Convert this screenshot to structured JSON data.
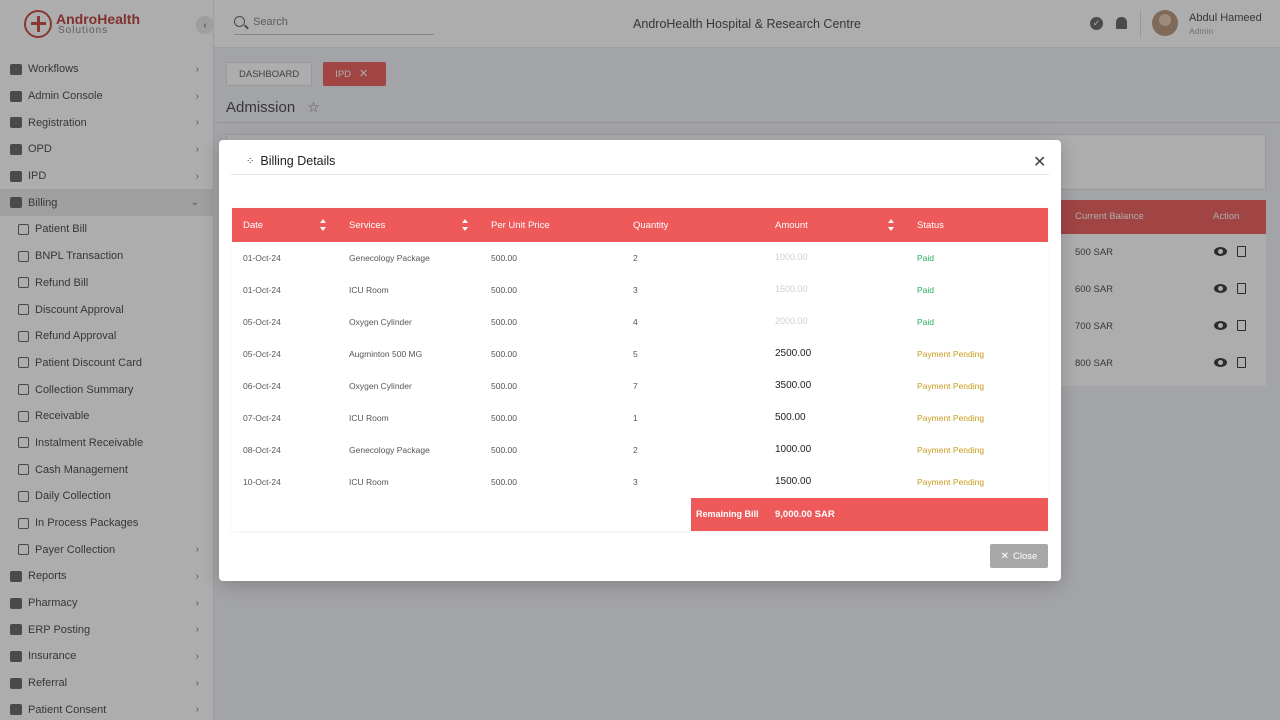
{
  "app": {
    "logo_title": "AndroHealth",
    "logo_subtitle": "Solutions",
    "hospital_name": "AndroHealth Hospital & Research Centre"
  },
  "search": {
    "placeholder": "Search"
  },
  "user": {
    "name": "Abdul Hameed",
    "role": "Admin"
  },
  "sidebar": {
    "items": [
      {
        "label": "Workflows",
        "icon": "workflow-icon",
        "chevron": "›"
      },
      {
        "label": "Admin Console",
        "icon": "gear-icon",
        "chevron": "›"
      },
      {
        "label": "Registration",
        "icon": "registration-icon",
        "chevron": "›"
      },
      {
        "label": "OPD",
        "icon": "opd-icon",
        "chevron": "›"
      },
      {
        "label": "IPD",
        "icon": "bed-icon",
        "chevron": "›"
      },
      {
        "label": "Billing",
        "icon": "billing-icon",
        "chevron": "⌄",
        "active": true
      },
      {
        "label": "Patient Bill",
        "icon": "bill-icon",
        "sub": true
      },
      {
        "label": "BNPL Transaction",
        "icon": "document-icon",
        "sub": true
      },
      {
        "label": "Refund Bill",
        "icon": "refund-icon",
        "sub": true
      },
      {
        "label": "Discount Approval",
        "icon": "discount-icon",
        "sub": true
      },
      {
        "label": "Refund Approval",
        "icon": "approval-icon",
        "sub": true
      },
      {
        "label": "Patient Discount Card",
        "icon": "card-icon",
        "sub": true
      },
      {
        "label": "Collection Summary",
        "icon": "summary-icon",
        "sub": true
      },
      {
        "label": "Receivable",
        "icon": "receivable-icon",
        "sub": true
      },
      {
        "label": "Instalment Receivable",
        "icon": "instalment-icon",
        "sub": true
      },
      {
        "label": "Cash Management",
        "icon": "cash-icon",
        "sub": true
      },
      {
        "label": "Daily Collection",
        "icon": "collection-icon",
        "sub": true
      },
      {
        "label": "In Process Packages",
        "icon": "package-icon",
        "sub": true
      },
      {
        "label": "Payer Collection",
        "icon": "payer-icon",
        "sub": true,
        "chevron": "›"
      },
      {
        "label": "Reports",
        "icon": "report-icon",
        "chevron": "›"
      },
      {
        "label": "Pharmacy",
        "icon": "pharmacy-icon",
        "chevron": "›"
      },
      {
        "label": "ERP Posting",
        "icon": "erp-icon",
        "chevron": "›"
      },
      {
        "label": "Insurance",
        "icon": "insurance-icon",
        "chevron": "›"
      },
      {
        "label": "Referral",
        "icon": "referral-icon",
        "chevron": "›"
      },
      {
        "label": "Patient Consent",
        "icon": "consent-icon",
        "chevron": "›"
      }
    ]
  },
  "tabs": {
    "dashboard": "DASHBOARD",
    "ipd": "IPD"
  },
  "page": {
    "title": "Admission"
  },
  "background_table": {
    "headers": [
      "Current Balance",
      "Action"
    ],
    "balances": [
      "500 SAR",
      "600 SAR",
      "700 SAR",
      "800 SAR"
    ]
  },
  "modal": {
    "title": "Billing Details",
    "headers": [
      "Date",
      "Services",
      "Per Unit Price",
      "Quantity",
      "Amount",
      "Status"
    ],
    "rows": [
      {
        "date": "01-Oct-24",
        "service": "Genecology Package",
        "price": "500.00",
        "qty": "2",
        "amount": "1000.00",
        "status": "Paid"
      },
      {
        "date": "01-Oct-24",
        "service": "ICU Room",
        "price": "500.00",
        "qty": "3",
        "amount": "1500.00",
        "status": "Paid"
      },
      {
        "date": "05-Oct-24",
        "service": "Oxygen Cylinder",
        "price": "500.00",
        "qty": "4",
        "amount": "2000.00",
        "status": "Paid"
      },
      {
        "date": "05-Oct-24",
        "service": "Augminton 500 MG",
        "price": "500.00",
        "qty": "5",
        "amount": "2500.00",
        "status": "Payment Pending"
      },
      {
        "date": "06-Oct-24",
        "service": "Oxygen Cylinder",
        "price": "500.00",
        "qty": "7",
        "amount": "3500.00",
        "status": "Payment Pending"
      },
      {
        "date": "07-Oct-24",
        "service": "ICU Room",
        "price": "500.00",
        "qty": "1",
        "amount": "500.00",
        "status": "Payment Pending"
      },
      {
        "date": "08-Oct-24",
        "service": "Genecology Package",
        "price": "500.00",
        "qty": "2",
        "amount": "1000.00",
        "status": "Payment Pending"
      },
      {
        "date": "10-Oct-24",
        "service": "ICU Room",
        "price": "500.00",
        "qty": "3",
        "amount": "1500.00",
        "status": "Payment Pending"
      }
    ],
    "remaining_label": "Remaining Bill",
    "remaining_value": "9,000.00 SAR",
    "close_label": "Close"
  },
  "colors": {
    "accent": "#ee5959",
    "paid": "#27ae60",
    "pending": "#c79a1a",
    "brand": "#b22a25"
  }
}
